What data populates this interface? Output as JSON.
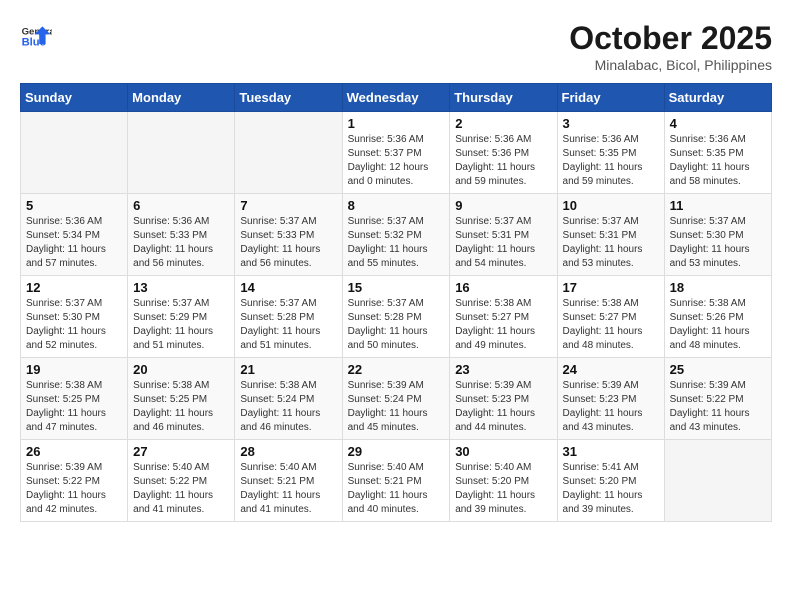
{
  "header": {
    "logo_general": "General",
    "logo_blue": "Blue",
    "month": "October 2025",
    "location": "Minalabac, Bicol, Philippines"
  },
  "weekdays": [
    "Sunday",
    "Monday",
    "Tuesday",
    "Wednesday",
    "Thursday",
    "Friday",
    "Saturday"
  ],
  "weeks": [
    [
      {
        "day": "",
        "info": ""
      },
      {
        "day": "",
        "info": ""
      },
      {
        "day": "",
        "info": ""
      },
      {
        "day": "1",
        "info": "Sunrise: 5:36 AM\nSunset: 5:37 PM\nDaylight: 12 hours\nand 0 minutes."
      },
      {
        "day": "2",
        "info": "Sunrise: 5:36 AM\nSunset: 5:36 PM\nDaylight: 11 hours\nand 59 minutes."
      },
      {
        "day": "3",
        "info": "Sunrise: 5:36 AM\nSunset: 5:35 PM\nDaylight: 11 hours\nand 59 minutes."
      },
      {
        "day": "4",
        "info": "Sunrise: 5:36 AM\nSunset: 5:35 PM\nDaylight: 11 hours\nand 58 minutes."
      }
    ],
    [
      {
        "day": "5",
        "info": "Sunrise: 5:36 AM\nSunset: 5:34 PM\nDaylight: 11 hours\nand 57 minutes."
      },
      {
        "day": "6",
        "info": "Sunrise: 5:36 AM\nSunset: 5:33 PM\nDaylight: 11 hours\nand 56 minutes."
      },
      {
        "day": "7",
        "info": "Sunrise: 5:37 AM\nSunset: 5:33 PM\nDaylight: 11 hours\nand 56 minutes."
      },
      {
        "day": "8",
        "info": "Sunrise: 5:37 AM\nSunset: 5:32 PM\nDaylight: 11 hours\nand 55 minutes."
      },
      {
        "day": "9",
        "info": "Sunrise: 5:37 AM\nSunset: 5:31 PM\nDaylight: 11 hours\nand 54 minutes."
      },
      {
        "day": "10",
        "info": "Sunrise: 5:37 AM\nSunset: 5:31 PM\nDaylight: 11 hours\nand 53 minutes."
      },
      {
        "day": "11",
        "info": "Sunrise: 5:37 AM\nSunset: 5:30 PM\nDaylight: 11 hours\nand 53 minutes."
      }
    ],
    [
      {
        "day": "12",
        "info": "Sunrise: 5:37 AM\nSunset: 5:30 PM\nDaylight: 11 hours\nand 52 minutes."
      },
      {
        "day": "13",
        "info": "Sunrise: 5:37 AM\nSunset: 5:29 PM\nDaylight: 11 hours\nand 51 minutes."
      },
      {
        "day": "14",
        "info": "Sunrise: 5:37 AM\nSunset: 5:28 PM\nDaylight: 11 hours\nand 51 minutes."
      },
      {
        "day": "15",
        "info": "Sunrise: 5:37 AM\nSunset: 5:28 PM\nDaylight: 11 hours\nand 50 minutes."
      },
      {
        "day": "16",
        "info": "Sunrise: 5:38 AM\nSunset: 5:27 PM\nDaylight: 11 hours\nand 49 minutes."
      },
      {
        "day": "17",
        "info": "Sunrise: 5:38 AM\nSunset: 5:27 PM\nDaylight: 11 hours\nand 48 minutes."
      },
      {
        "day": "18",
        "info": "Sunrise: 5:38 AM\nSunset: 5:26 PM\nDaylight: 11 hours\nand 48 minutes."
      }
    ],
    [
      {
        "day": "19",
        "info": "Sunrise: 5:38 AM\nSunset: 5:25 PM\nDaylight: 11 hours\nand 47 minutes."
      },
      {
        "day": "20",
        "info": "Sunrise: 5:38 AM\nSunset: 5:25 PM\nDaylight: 11 hours\nand 46 minutes."
      },
      {
        "day": "21",
        "info": "Sunrise: 5:38 AM\nSunset: 5:24 PM\nDaylight: 11 hours\nand 46 minutes."
      },
      {
        "day": "22",
        "info": "Sunrise: 5:39 AM\nSunset: 5:24 PM\nDaylight: 11 hours\nand 45 minutes."
      },
      {
        "day": "23",
        "info": "Sunrise: 5:39 AM\nSunset: 5:23 PM\nDaylight: 11 hours\nand 44 minutes."
      },
      {
        "day": "24",
        "info": "Sunrise: 5:39 AM\nSunset: 5:23 PM\nDaylight: 11 hours\nand 43 minutes."
      },
      {
        "day": "25",
        "info": "Sunrise: 5:39 AM\nSunset: 5:22 PM\nDaylight: 11 hours\nand 43 minutes."
      }
    ],
    [
      {
        "day": "26",
        "info": "Sunrise: 5:39 AM\nSunset: 5:22 PM\nDaylight: 11 hours\nand 42 minutes."
      },
      {
        "day": "27",
        "info": "Sunrise: 5:40 AM\nSunset: 5:22 PM\nDaylight: 11 hours\nand 41 minutes."
      },
      {
        "day": "28",
        "info": "Sunrise: 5:40 AM\nSunset: 5:21 PM\nDaylight: 11 hours\nand 41 minutes."
      },
      {
        "day": "29",
        "info": "Sunrise: 5:40 AM\nSunset: 5:21 PM\nDaylight: 11 hours\nand 40 minutes."
      },
      {
        "day": "30",
        "info": "Sunrise: 5:40 AM\nSunset: 5:20 PM\nDaylight: 11 hours\nand 39 minutes."
      },
      {
        "day": "31",
        "info": "Sunrise: 5:41 AM\nSunset: 5:20 PM\nDaylight: 11 hours\nand 39 minutes."
      },
      {
        "day": "",
        "info": ""
      }
    ]
  ]
}
